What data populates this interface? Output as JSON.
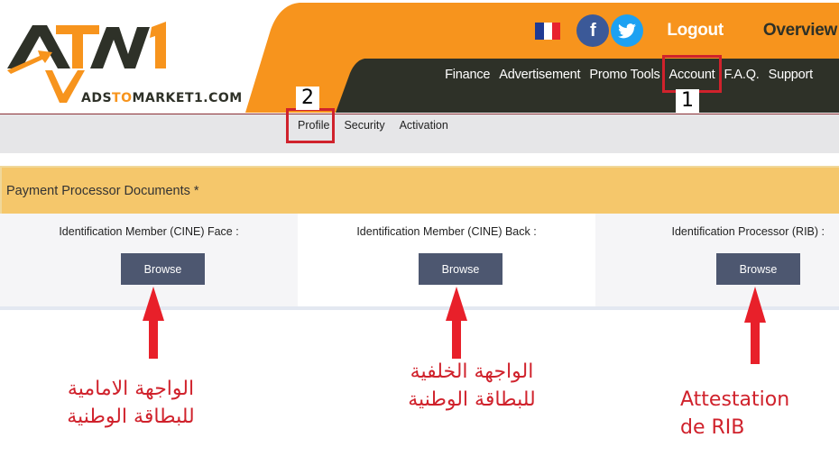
{
  "header": {
    "logo": {
      "brand": "ATM1",
      "domain_prefix": "ADS",
      "domain_accent": "TO",
      "domain_suffix": "MARKET1.COM"
    },
    "top_links": {
      "language_flag": "france-flag-icon",
      "facebook_glyph": "f",
      "twitter_glyph": "🐦",
      "logout": "Logout",
      "overview": "Overview"
    },
    "main_nav": [
      "Finance",
      "Advertisement",
      "Promo Tools",
      "Account",
      "F.A.Q.",
      "Support"
    ],
    "sub_nav": [
      "Profile",
      "Security",
      "Activation"
    ]
  },
  "annotations": {
    "step_1": "1",
    "step_2": "2",
    "note_front": [
      "الواجهة الامامية",
      "للبطاقة الوطنية"
    ],
    "note_back": [
      "الواجهة الخلفية",
      "للبطاقة الوطنية"
    ],
    "note_rib": [
      "Attestation",
      "de RIB"
    ]
  },
  "panel": {
    "title": "Payment Processor Documents",
    "required_mark": "*",
    "fields": [
      {
        "label": "Identification Member (CINE) Face :",
        "button": "Browse"
      },
      {
        "label": "Identification Member (CINE) Back :",
        "button": "Browse"
      },
      {
        "label": "Identification Processor (RIB) :",
        "button": "Browse"
      }
    ]
  },
  "colors": {
    "orange": "#f7941d",
    "dark_nav": "#2e3128",
    "panel_header": "#f5c76b",
    "browse_button": "#4d5770",
    "annotation_red": "#d0222c"
  }
}
